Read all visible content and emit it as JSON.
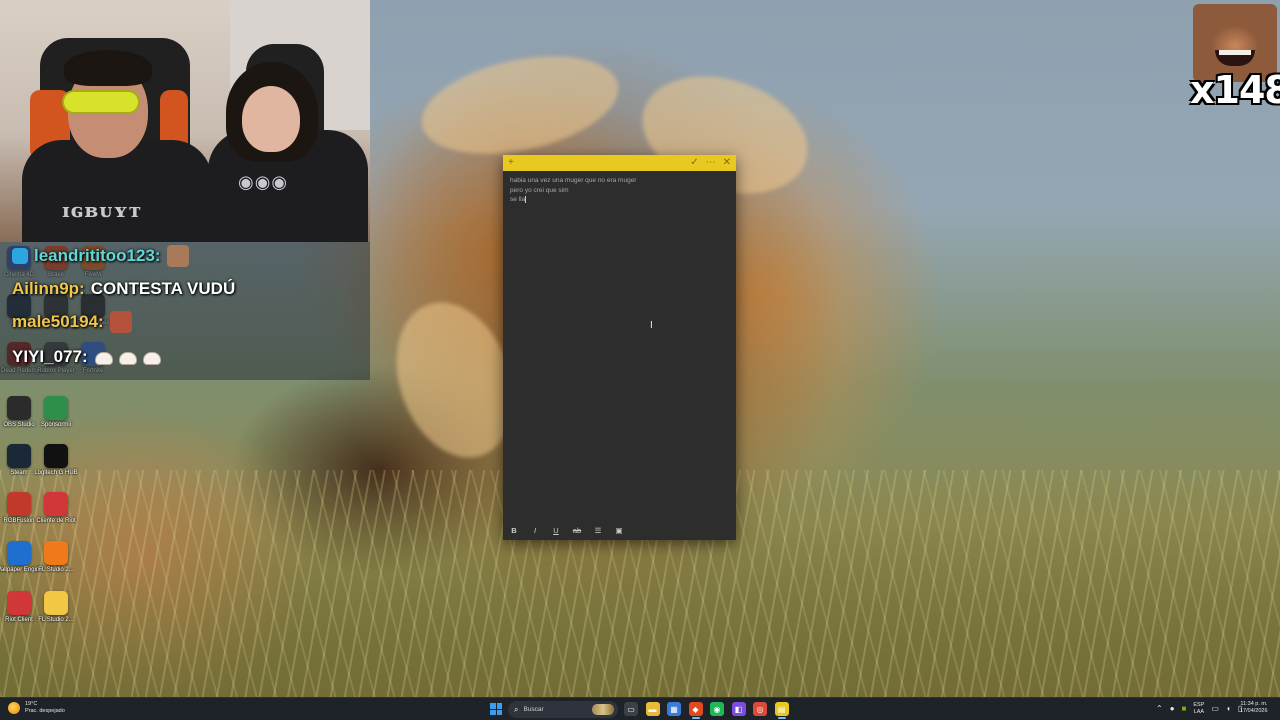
{
  "overlay": {
    "emote_counter": "x148"
  },
  "chat": {
    "messages": [
      {
        "user": "leandrititoo123:",
        "user_color": "#5fd8d8",
        "text": ""
      },
      {
        "user": "Ailinn9p:",
        "user_color": "#f0c64a",
        "text": "CONTESTA VUDÚ"
      },
      {
        "user": "male50194:",
        "user_color": "#f0c64a",
        "text": ""
      },
      {
        "user": "YIYI_077:",
        "user_color": "#ffffff",
        "text": ""
      }
    ]
  },
  "desktop_icons": [
    {
      "label": "Cinema 4D",
      "icon": "cinema4d-icon",
      "color": "#3552a5"
    },
    {
      "label": "Brave",
      "icon": "brave-icon",
      "color": "#e04a1e"
    },
    {
      "label": "FiveM",
      "icon": "fivem-icon",
      "color": "#e36b1f"
    },
    {
      "label": "Steam",
      "icon": "steam-icon",
      "color": "#1b2838"
    },
    {
      "label": "Unity Hub",
      "icon": "unity-icon",
      "color": "#333333"
    },
    {
      "label": "Epic Games",
      "icon": "epic-icon",
      "color": "#2a2a2a"
    },
    {
      "label": "Red Dead Redemption",
      "icon": "rdr-icon",
      "color": "#8b1e1e"
    },
    {
      "label": "Roblox Player",
      "icon": "roblox-icon",
      "color": "#444444"
    },
    {
      "label": "Fortnite",
      "icon": "fortnite-icon",
      "color": "#3b6fd8"
    },
    {
      "label": "OBS Studio",
      "icon": "obs-icon",
      "color": "#2b2b2b"
    },
    {
      "label": "Sponsormii",
      "icon": "sponsormii-icon",
      "color": "#2f8f4a"
    },
    {
      "label": "Steam",
      "icon": "steam-icon",
      "color": "#1b2838"
    },
    {
      "label": "Logitech G HUB",
      "icon": "logitech-icon",
      "color": "#111111"
    },
    {
      "label": "RGBFusion",
      "icon": "rgbfusion-icon",
      "color": "#c0392b"
    },
    {
      "label": "Cliente de Riot",
      "icon": "riot-icon",
      "color": "#d13639"
    },
    {
      "label": "Wallpaper Engine",
      "icon": "wallpaper-engine-icon",
      "color": "#1e6fd0"
    },
    {
      "label": "FL Studio 2...",
      "icon": "flstudio-icon",
      "color": "#f07a1a"
    },
    {
      "label": "Riot Client",
      "icon": "riot-icon",
      "color": "#d13639"
    },
    {
      "label": "FL Studio 2...",
      "icon": "folder-icon",
      "color": "#f2c744"
    }
  ],
  "sticky_note": {
    "lines": [
      "habia una vez una muger que no era muger",
      "pero yo crei que sim",
      "se lla"
    ],
    "toolbar": {
      "bold": "B",
      "italic": "I",
      "underline": "U",
      "strike": "ab",
      "list": "☰",
      "image": "▣"
    },
    "accent_color": "#e9c91f",
    "bar_icons": [
      "add-icon",
      "check-icon",
      "more-icon",
      "close-icon"
    ]
  },
  "taskbar": {
    "weather_temp": "19°C",
    "weather_desc": "Prac. despejado",
    "search_placeholder": "Buscar",
    "lang_top": "ESP",
    "lang_bottom": "LAA",
    "time": "11:34 p. m.",
    "date": "17/04/2026",
    "apps": [
      {
        "name": "task-view-icon",
        "color": "#3b4048",
        "active": false
      },
      {
        "name": "file-explorer-icon",
        "color": "#e9b93a",
        "active": false
      },
      {
        "name": "store-icon",
        "color": "#3a7bd5",
        "active": false
      },
      {
        "name": "brave-icon",
        "color": "#e04a1e",
        "active": true
      },
      {
        "name": "spotify-icon",
        "color": "#1db954",
        "active": false
      },
      {
        "name": "twitch-icon",
        "color": "#7c4ddb",
        "active": false
      },
      {
        "name": "chrome-icon",
        "color": "#d94a3a",
        "active": false
      },
      {
        "name": "sticky-notes-icon",
        "color": "#e9c91f",
        "active": true
      }
    ]
  }
}
